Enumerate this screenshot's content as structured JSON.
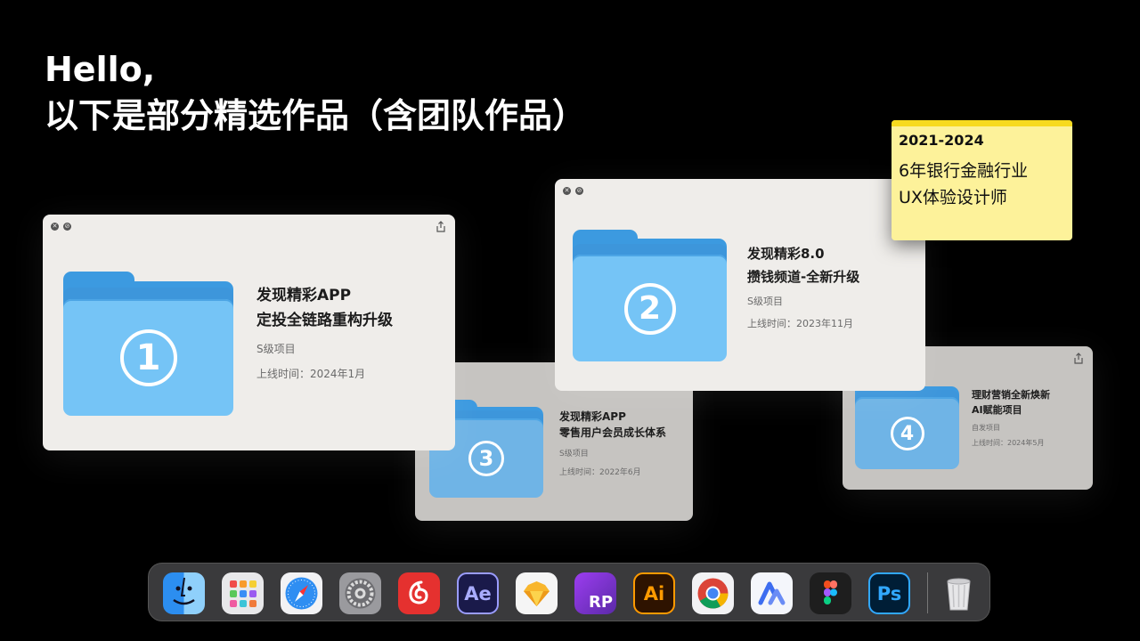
{
  "headline": {
    "line1": "Hello,",
    "line2": "以下是部分精选作品（含团队作品）"
  },
  "note": {
    "years": "2021-2024",
    "line1": "6年银行金融行业",
    "line2": "UX体验设计师"
  },
  "cards": {
    "c1": {
      "num": "1",
      "title1": "发现精彩APP",
      "title2": "定投全链路重构升级",
      "grade": "S级项目",
      "date": "上线时间：2024年1月"
    },
    "c2": {
      "num": "2",
      "title1": "发现精彩8.0",
      "title2": "攒钱频道-全新升级",
      "grade": "S级项目",
      "date": "上线时间：2023年11月"
    },
    "c3": {
      "num": "3",
      "title1": "发现精彩APP",
      "title2": "零售用户会员成长体系",
      "grade": "S级项目",
      "date": "上线时间：2022年6月"
    },
    "c4": {
      "num": "4",
      "title1": "理财营销全新焕新",
      "title2": "AI赋能项目",
      "grade": "自发项目",
      "date": "上线时间：2024年5月"
    }
  },
  "dock": {
    "ae": "Ae",
    "ai": "Ai",
    "ps": "Ps",
    "rp": "RP",
    "icons": [
      "finder-icon",
      "launchpad-icon",
      "safari-icon",
      "system-settings-icon",
      "netease-music-icon",
      "after-effects-icon",
      "sketch-icon",
      "axure-rp-icon",
      "illustrator-icon",
      "chrome-icon",
      "lanhu-icon",
      "figma-icon",
      "photoshop-icon",
      "trash-icon"
    ]
  }
}
